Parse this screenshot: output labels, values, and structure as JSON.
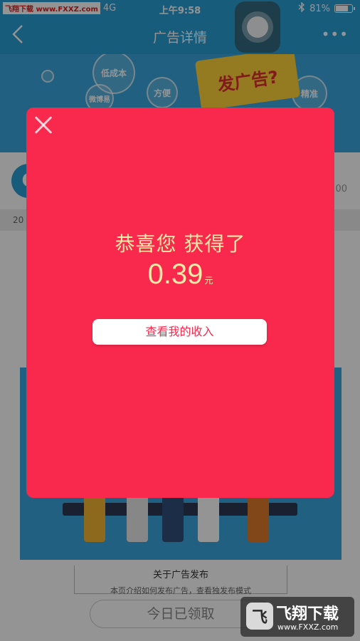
{
  "status_bar": {
    "watermark": "飞翔下载 www.FXXZ.com",
    "network": "4G",
    "time": "上午9:58",
    "bluetooth_icon": "bluetooth-icon",
    "battery_text": "81%",
    "battery_level": 0.81
  },
  "nav": {
    "back_icon": "chevron-left-icon",
    "title": "广告详情",
    "more_icon": "more-dots-icon"
  },
  "banner": {
    "bubbles": [
      "低成本",
      "微博易",
      "方便",
      "精准"
    ],
    "slogan": "发广告?"
  },
  "account": {
    "number_tail": "00"
  },
  "date_row": {
    "text": "20"
  },
  "article": {
    "about_title": "关于广告发布",
    "about_sub": "本页介绍如何发布广告，查看独发布模式"
  },
  "received_button": "今日已领取",
  "modal": {
    "close_icon": "close-icon",
    "congrats": "恭喜您 获得了",
    "amount": "0.39",
    "unit": "元",
    "income_button": "查看我的收入"
  },
  "watermark_bottom": {
    "icon_text": "飞",
    "brand": "飞翔下载",
    "url": "www.FXXZ.com"
  },
  "colors": {
    "modal_bg": "#f8294d",
    "accent_text": "#ffe9a6",
    "nav_bg": "#2a9fd6"
  }
}
